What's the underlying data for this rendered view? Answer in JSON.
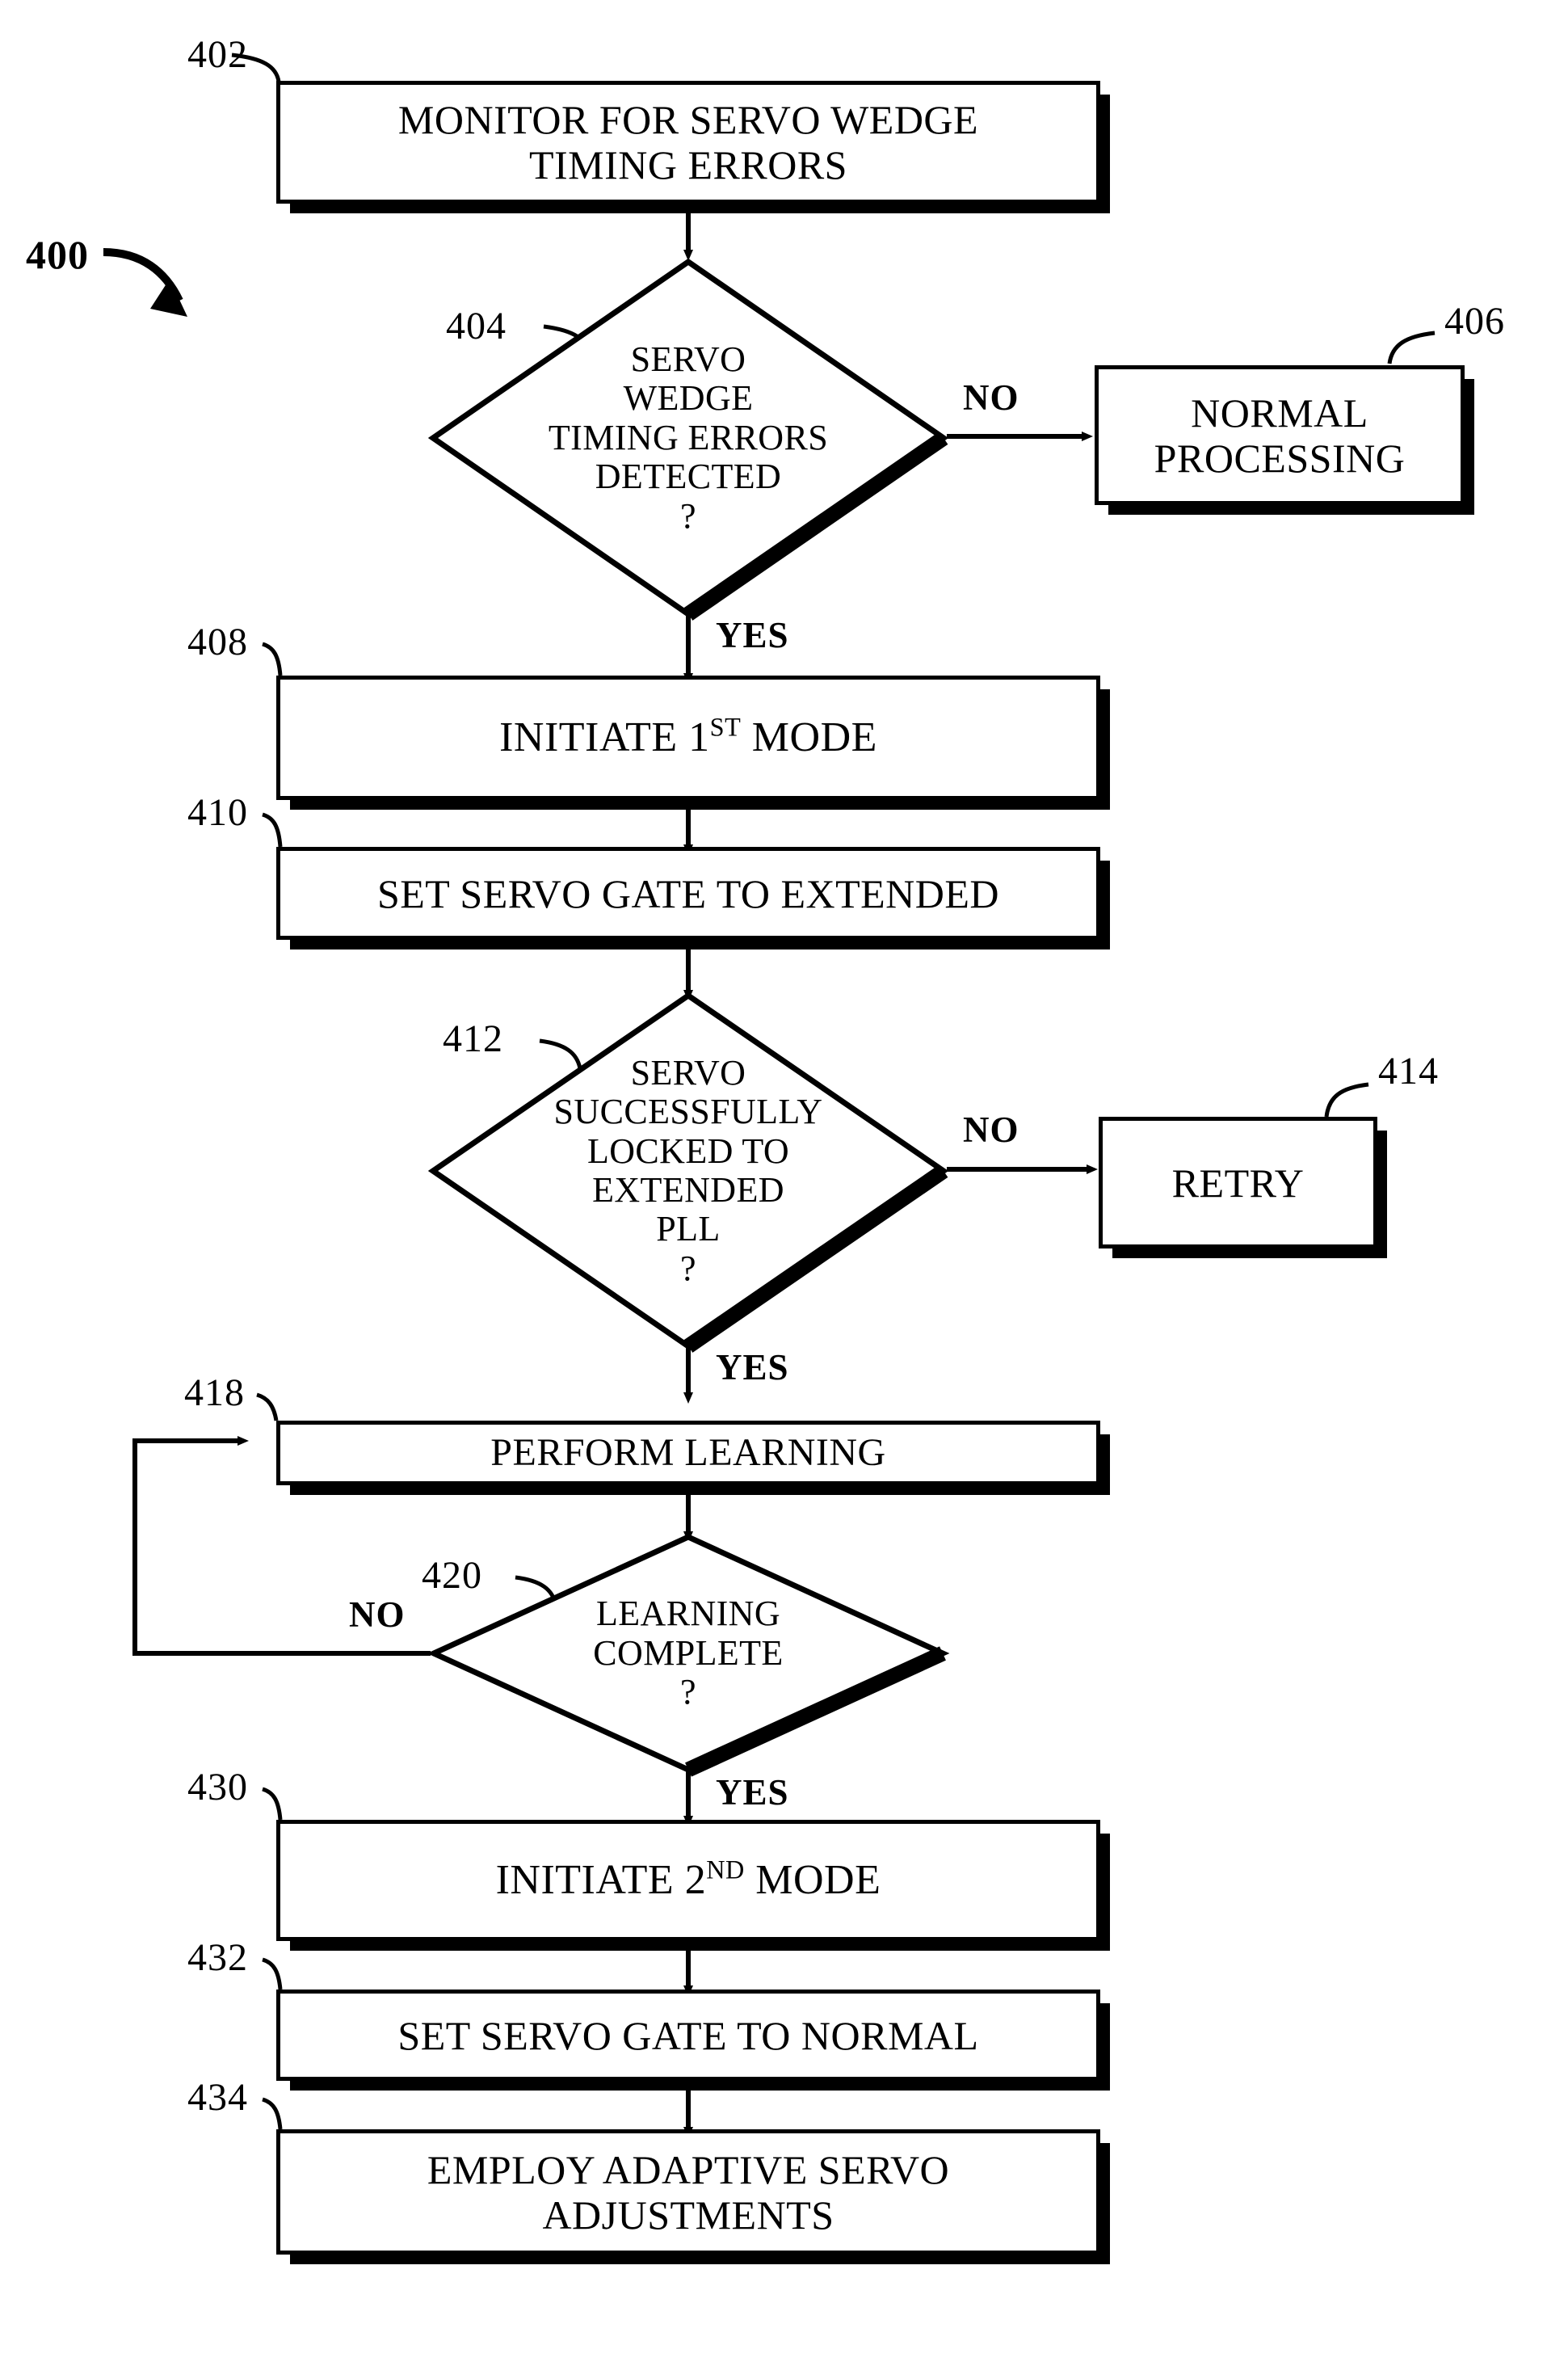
{
  "figure": {
    "id_label": "400"
  },
  "nodes": {
    "n402": {
      "ref": "402",
      "text": "MONITOR FOR SERVO WEDGE\nTIMING ERRORS"
    },
    "n404": {
      "ref": "404",
      "text": "SERVO\nWEDGE\nTIMING ERRORS\nDETECTED\n?"
    },
    "n406": {
      "ref": "406",
      "text": "NORMAL\nPROCESSING"
    },
    "n408": {
      "ref": "408",
      "text_pre": "INITIATE 1",
      "text_sup": "ST",
      "text_post": " MODE"
    },
    "n410": {
      "ref": "410",
      "text": "SET SERVO GATE TO EXTENDED"
    },
    "n412": {
      "ref": "412",
      "text": "SERVO\nSUCCESSFULLY\nLOCKED TO\nEXTENDED\nPLL\n?"
    },
    "n414": {
      "ref": "414",
      "text": "RETRY"
    },
    "n418": {
      "ref": "418",
      "text": "PERFORM LEARNING"
    },
    "n420": {
      "ref": "420",
      "text": "LEARNING\nCOMPLETE\n?"
    },
    "n430": {
      "ref": "430",
      "text_pre": "INITIATE 2",
      "text_sup": "ND",
      "text_post": " MODE"
    },
    "n432": {
      "ref": "432",
      "text": "SET SERVO GATE TO NORMAL"
    },
    "n434": {
      "ref": "434",
      "text": "EMPLOY ADAPTIVE SERVO\nADJUSTMENTS"
    }
  },
  "branches": {
    "b404_no": "NO",
    "b404_yes": "YES",
    "b412_no": "NO",
    "b412_yes": "YES",
    "b420_no": "NO",
    "b420_yes": "YES"
  },
  "colors": {
    "stroke": "#000000",
    "fill": "#ffffff"
  }
}
